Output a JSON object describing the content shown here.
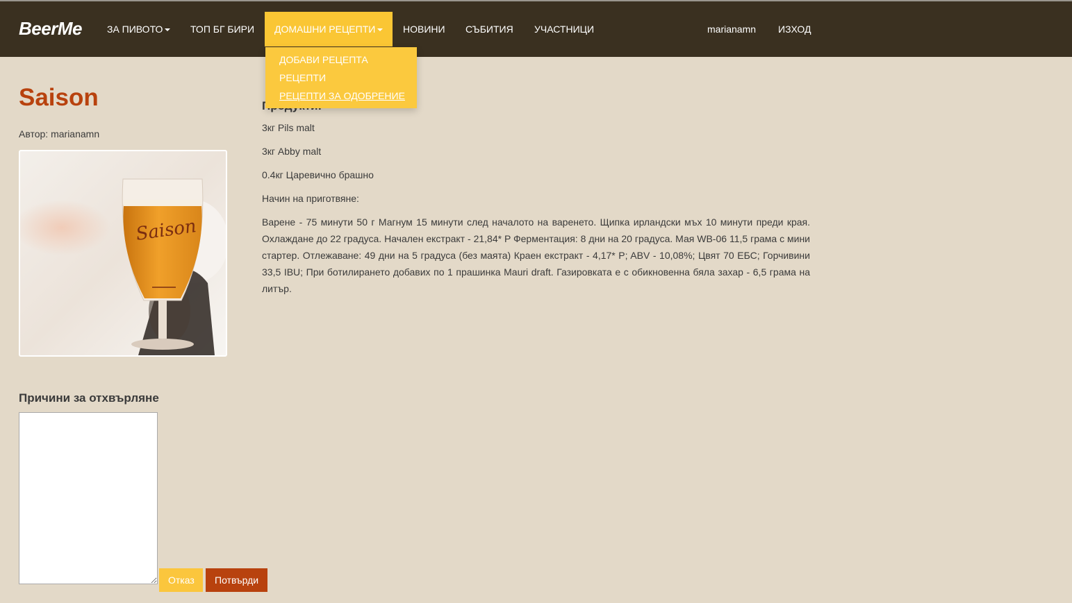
{
  "nav": {
    "brand": "BeerMe",
    "items": [
      {
        "label": "ЗА ПИВОТО",
        "has_caret": true
      },
      {
        "label": "ТОП БГ БИРИ",
        "has_caret": false
      },
      {
        "label": "ДОМАШНИ РЕЦЕПТИ",
        "has_caret": true,
        "active": true
      },
      {
        "label": "НОВИНИ",
        "has_caret": false
      },
      {
        "label": "СЪБИТИЯ",
        "has_caret": false
      },
      {
        "label": "УЧАСТНИЦИ",
        "has_caret": false
      }
    ],
    "user": "marianamn",
    "logout": "ИЗХОД",
    "dropdown": [
      {
        "label": "ДОБАВИ РЕЦЕПТА"
      },
      {
        "label": "РЕЦЕПТИ"
      },
      {
        "label": "РЕЦЕПТИ ЗА ОДОБРЕНИЕ",
        "hover": true
      }
    ]
  },
  "recipe": {
    "title": "Saison",
    "author_label": "Автор:",
    "author_name": "marianamn",
    "image_alt": "Saison beer glass",
    "image_text": "Saison",
    "products_heading": "Продукти:",
    "ingredients": [
      "3кг Pils malt",
      "3кг Abby malt",
      "0.4кг Царевично брашно"
    ],
    "method_label": "Начин на приготвяне:",
    "method_text": "Варене - 75 минути 50 г Магнум 15 минути след началото на варенето. Щипка ирландски мъх 10 минути преди края. Охлаждане до 22 градуса. Начален екстракт - 21,84* P Ферментация: 8 дни на 20 градуса. Мая WB-06 11,5 грама с мини стартер. Отлежаване: 49 дни на 5 градуса (без маята) Краен екстракт - 4,17* P; ABV - 10,08%; Цвят 70 ЕБС; Горчивини 33,5 IBU; При ботилирането добавих по 1 прашинка Mauri draft. Газировката е с обикновенна бяла захар - 6,5 грама на литър."
  },
  "rejection": {
    "heading": "Причини за отхвърляне",
    "textarea_value": "",
    "cancel_label": "Отказ",
    "confirm_label": "Потвърди"
  },
  "colors": {
    "navbar": "#3a3020",
    "accent_yellow": "#fac634",
    "accent_red": "#b8420e",
    "background": "#e3d9c8"
  }
}
